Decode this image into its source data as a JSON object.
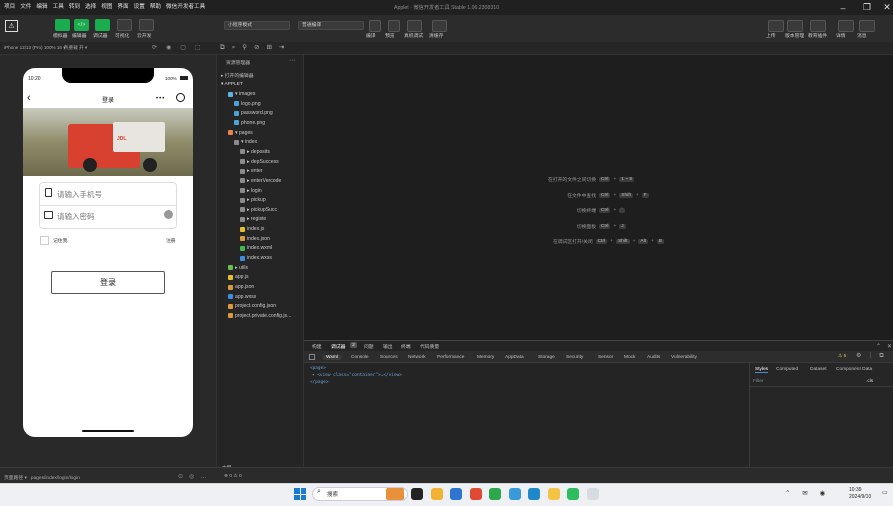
{
  "menu": [
    "项目",
    "文件",
    "编辑",
    "工具",
    "转到",
    "选择",
    "视图",
    "界面",
    "设置",
    "帮助",
    "微信开发者工具"
  ],
  "title": "Applet · 微信开发者工具 Stable 1.06.2308310",
  "toolbar": {
    "groups": [
      "模拟器",
      "编辑器",
      "调试器",
      "可视化",
      "云开发"
    ],
    "mode": "小程序模式",
    "compile": "普通编译",
    "actions": [
      "编译",
      "预览",
      "真机调试",
      "清缓存"
    ],
    "right": [
      "上传",
      "版本管理",
      "教育插件",
      "详情",
      "消息"
    ],
    "code_label": "</>"
  },
  "sim": {
    "device": "iPhone 12/13 (Pro) 100% 16 ▾",
    "hotreload": "热重载 开 ▾",
    "time": "10:20",
    "battery": "100%",
    "nav_title": "登录",
    "phone_placeholder": "请输入手机号",
    "password_placeholder": "请输入密码",
    "remember": "记住我",
    "register": "注册",
    "login_btn": "登录"
  },
  "explorer": {
    "header": "资源管理器",
    "open": "▸ 打开的编辑器",
    "root": "▾ APPLET",
    "items": [
      {
        "t": "▾ images",
        "d": 1,
        "c": "#5bb3e8"
      },
      {
        "t": "logo.png",
        "d": 2,
        "c": "#49a5d8"
      },
      {
        "t": "password.png",
        "d": 2,
        "c": "#49a5d8"
      },
      {
        "t": "phone.png",
        "d": 2,
        "c": "#49a5d8"
      },
      {
        "t": "▾ pages",
        "d": 1,
        "c": "#e8834a"
      },
      {
        "t": "▾ index",
        "d": 2,
        "c": "#8b8b8b"
      },
      {
        "t": "▸ deposits",
        "d": 3,
        "c": "#8b8b8b"
      },
      {
        "t": "▸ depSuccess",
        "d": 3,
        "c": "#8b8b8b"
      },
      {
        "t": "▸ enter",
        "d": 3,
        "c": "#8b8b8b"
      },
      {
        "t": "▸ enterVercode",
        "d": 3,
        "c": "#8b8b8b"
      },
      {
        "t": "▸ login",
        "d": 3,
        "c": "#8b8b8b"
      },
      {
        "t": "▸ pickup",
        "d": 3,
        "c": "#8b8b8b"
      },
      {
        "t": "▸ pickupSucc",
        "d": 3,
        "c": "#8b8b8b"
      },
      {
        "t": "▸ registe",
        "d": 3,
        "c": "#8b8b8b"
      },
      {
        "t": "index.js",
        "d": 3,
        "c": "#e5c12e"
      },
      {
        "t": "index.json",
        "d": 3,
        "c": "#d89a3a"
      },
      {
        "t": "index.wxml",
        "d": 3,
        "c": "#3dbb4a"
      },
      {
        "t": "index.wxss",
        "d": 3,
        "c": "#3a8de0"
      },
      {
        "t": "▸ utils",
        "d": 1,
        "c": "#6cba4a"
      },
      {
        "t": "app.js",
        "d": 1,
        "c": "#e5c12e"
      },
      {
        "t": "app.json",
        "d": 1,
        "c": "#d89a3a"
      },
      {
        "t": "app.wxss",
        "d": 1,
        "c": "#3a8de0"
      },
      {
        "t": "project.config.json",
        "d": 1,
        "c": "#d89a3a"
      },
      {
        "t": "project.private.config.js...",
        "d": 1,
        "c": "#d89a3a"
      }
    ],
    "outline": "▸ 大纲"
  },
  "hints": [
    {
      "label": "在打开的文件之间切换",
      "keys": [
        "Ctrl",
        "1 ~ 9"
      ]
    },
    {
      "label": "在文件中查找",
      "keys": [
        "Ctrl",
        "Shift",
        "F"
      ]
    },
    {
      "label": "切换终端",
      "keys": [
        "Ctrl",
        "`"
      ]
    },
    {
      "label": "切换面板",
      "keys": [
        "Ctrl",
        "J"
      ]
    },
    {
      "label": "在调试区打开/关闭",
      "keys": [
        "Ctrl",
        "Shift",
        "Alt",
        "B"
      ]
    }
  ],
  "devtools": {
    "top_tabs": [
      "构建",
      "调试器",
      "问题",
      "输出",
      "终端",
      "代码质量"
    ],
    "badge": "2",
    "tabs": [
      "Wxml",
      "Console",
      "Sources",
      "Network",
      "Performance",
      "Memory",
      "AppData",
      "Storage",
      "Security",
      "Sensor",
      "Mock",
      "Audits",
      "Vulnerability"
    ],
    "warn": "⚠ 5",
    "code": [
      "<page>",
      "▾ <view class=\"container\">…</view>",
      "</page>"
    ],
    "side_tabs": [
      "Styles",
      "Computed",
      "Dataset",
      "Component Data"
    ],
    "filter": "Filter",
    "cls": ".cls"
  },
  "status": {
    "path": "页面路径 ▾   pages/index/login/login",
    "problems": "⊗ 0 ⚠ 0"
  },
  "taskbar": {
    "search": "搜索",
    "time": "10:39",
    "date": "2024/9/10"
  }
}
